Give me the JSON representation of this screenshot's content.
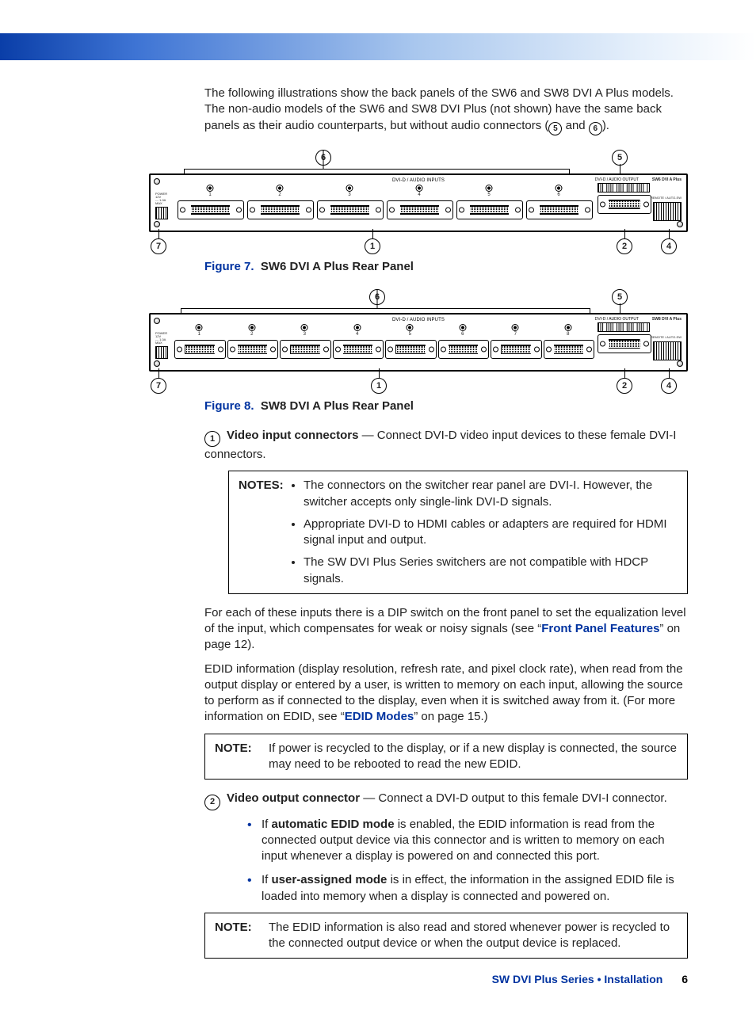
{
  "intro": {
    "p1": "The following illustrations show the back panels of the SW6 and SW8 DVI A Plus models. The non-audio models of the SW6 and SW8 DVI Plus (not shown) have the same back panels as their audio counterparts, but without audio connectors (",
    "p1_end": ")."
  },
  "callouts_inline": {
    "c5": "5",
    "c6": "6",
    "and": " and "
  },
  "figures": {
    "fig7": {
      "num": "Figure 7.",
      "title": "SW6 DVI A Plus Rear Panel"
    },
    "fig8": {
      "num": "Figure 8.",
      "title": "SW8 DVI A Plus Rear Panel"
    }
  },
  "panel_labels": {
    "inputs": "DVI-D / AUDIO INPUTS",
    "output": "DVI-D / AUDIO OUTPUT",
    "model6": "SW6 DVI A Plus",
    "model8": "SW8 DVI A Plus",
    "remote": "REMOTE / AUTO-SW",
    "power": "POWER",
    "power_spec": "12V\n--- 1.0A\nMAX"
  },
  "diagram_callouts": {
    "c1": "1",
    "c2": "2",
    "c4": "4",
    "c5": "5",
    "c6": "6",
    "c7": "7"
  },
  "item1": {
    "num": "1",
    "lead": "Video input connectors",
    "text": " — Connect DVI-D video input devices to these female DVI-I connectors.",
    "notes_label": "NOTES:",
    "notes": [
      "The connectors on the switcher rear panel are DVI-I. However, the switcher accepts only single-link DVI-D signals.",
      "Appropriate DVI-D to HDMI cables or adapters are required for HDMI signal input and output.",
      "The SW DVI Plus Series switchers are not compatible with HDCP signals."
    ],
    "para2a": "For each of these inputs there is a DIP switch on the front panel to set the equalization level of the input, which compensates for weak or noisy signals (see “",
    "link1": "Front Panel Features",
    "para2b": "” on page 12).",
    "para3a": "EDID information (display resolution, refresh rate, and pixel clock rate), when read from the output display or entered by a user, is written to memory on each input, allowing the source to perform as if connected to the display, even when it is switched away from it. (For more information on EDID, see “",
    "link2": "EDID Modes",
    "para3b": "” on page 15.)",
    "note2_label": "NOTE:",
    "note2": "If power is recycled to the display, or if a new display is connected, the source may need to be rebooted to read the new EDID."
  },
  "item2": {
    "num": "2",
    "lead": "Video output connector",
    "text": " — Connect a DVI-D output to this female DVI-I connector.",
    "b1a": "If ",
    "b1b": "automatic EDID mode",
    "b1c": " is enabled, the EDID information is read from the connected output device via this connector and is written to memory on each input whenever a display is powered on and connected this port.",
    "b2a": "If ",
    "b2b": "user-assigned mode",
    "b2c": " is in effect, the information in the assigned EDID file is loaded into memory when a display is connected and powered on.",
    "note_label": "NOTE:",
    "note": "The EDID information is also read and stored whenever power is recycled to the connected output device or when the output device is replaced."
  },
  "footer": {
    "title": "SW DVI Plus Series • Installation",
    "page": "6"
  }
}
